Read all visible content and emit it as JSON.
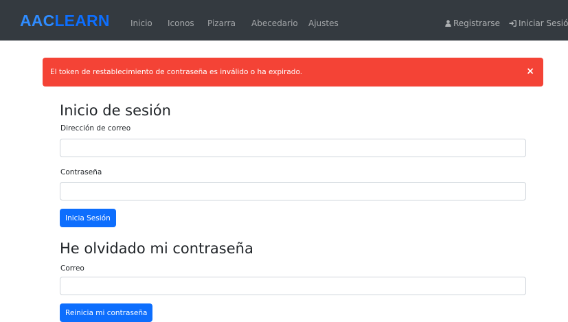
{
  "navbar": {
    "brand_part1": "AAC",
    "brand_part2": "LEARN",
    "links": [
      "Inicio",
      "Iconos",
      "Pizarra",
      "Abecedario",
      "Ajustes"
    ],
    "register_label": "Registrarse",
    "login_label": "Iniciar Sesión"
  },
  "alert": {
    "message": "El token de restablecimiento de contraseña es inválido o ha expirado.",
    "close_symbol": "×"
  },
  "login": {
    "title": "Inicio de sesión",
    "email_label": "Dirección de correo",
    "email_value": "",
    "password_label": "Contraseña",
    "password_value": "",
    "submit_label": "Inicia Sesión"
  },
  "forgot": {
    "title": "He olvidado mi contraseña",
    "email_label": "Correo",
    "email_value": "",
    "submit_label": "Reinicia mi contraseña"
  },
  "colors": {
    "navbar_bg": "#343a40",
    "brand_blue": "#2f8cff",
    "alert_bg": "#f44336",
    "primary": "#0d6efd"
  }
}
